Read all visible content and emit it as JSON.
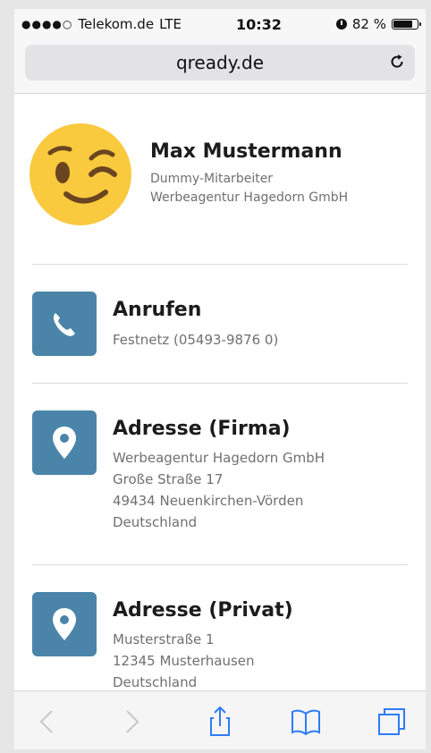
{
  "status_bar": {
    "signal": "●●●●○",
    "carrier": "Telekom.de",
    "network": "LTE",
    "time": "10:32",
    "battery_text": "82 %",
    "battery_level": 0.82
  },
  "browser": {
    "url": "qready.de"
  },
  "profile": {
    "name": "Max Mustermann",
    "role": "Dummy-Mitarbeiter",
    "company": "Werbeagentur Hagedorn GmbH",
    "avatar_icon": "winking-face-emoji"
  },
  "cards": [
    {
      "icon": "phone-icon",
      "title": "Anrufen",
      "lines": [
        "Festnetz (05493-9876 0)"
      ]
    },
    {
      "icon": "location-pin-icon",
      "title": "Adresse (Firma)",
      "lines": [
        "Werbeagentur Hagedorn GmbH",
        "Große Straße 17",
        "49434 Neuenkirchen-Vörden",
        "Deutschland"
      ]
    },
    {
      "icon": "location-pin-icon",
      "title": "Adresse (Privat)",
      "lines": [
        "Musterstraße 1",
        "12345 Musterhausen",
        "Deutschland"
      ]
    }
  ],
  "toolbar": {
    "icons": [
      "back-icon",
      "forward-icon",
      "share-icon",
      "bookmarks-icon",
      "tabs-icon"
    ]
  },
  "colors": {
    "tile": "#4a85a9",
    "emoji": "#f9c93e"
  }
}
